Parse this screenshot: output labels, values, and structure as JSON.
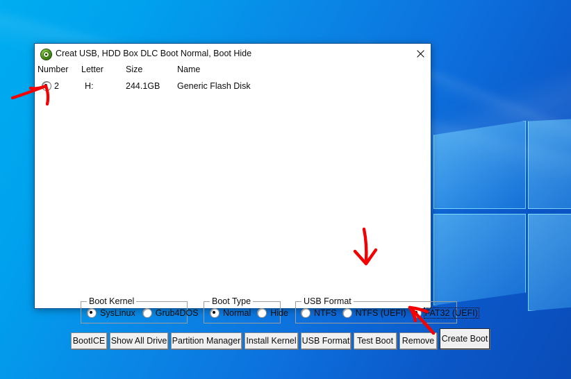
{
  "window": {
    "title": "Creat USB, HDD Box DLC Boot Normal, Boot Hide",
    "icon": "green-disc-icon",
    "close_label": "×"
  },
  "list": {
    "columns": [
      "Number",
      "Letter",
      "Size",
      "Name"
    ],
    "rows": [
      {
        "selected": true,
        "number": "2",
        "letter": "H:",
        "size": "244.1GB",
        "name": "Generic Flash Disk"
      }
    ]
  },
  "groups": [
    {
      "id": "boot-kernel",
      "title": "Boot Kernel",
      "options": [
        {
          "label": "SysLinux",
          "checked": true,
          "focused": false
        },
        {
          "label": "Grub4DOS",
          "checked": false,
          "focused": false
        }
      ]
    },
    {
      "id": "boot-type",
      "title": "Boot Type",
      "options": [
        {
          "label": "Normal",
          "checked": true,
          "focused": false
        },
        {
          "label": "Hide",
          "checked": false,
          "focused": false
        }
      ]
    },
    {
      "id": "usb-format",
      "title": "USB Format",
      "options": [
        {
          "label": "NTFS",
          "checked": false,
          "focused": false
        },
        {
          "label": "NTFS (UEFI)",
          "checked": false,
          "focused": false
        },
        {
          "label": "FAT32 (UEFI)",
          "checked": true,
          "focused": true
        }
      ]
    }
  ],
  "buttons": [
    {
      "label": "BootICE",
      "default": false
    },
    {
      "label": "Show All Drive",
      "default": false
    },
    {
      "label": "Partition Manager",
      "default": false
    },
    {
      "label": "Install Kernel",
      "default": false
    },
    {
      "label": "USB Format",
      "default": false
    },
    {
      "label": "Test Boot",
      "default": false
    },
    {
      "label": "Remove",
      "default": false
    },
    {
      "label": "Create Boot",
      "default": true
    }
  ],
  "annotations": {
    "color": "#f50000",
    "arrows": [
      {
        "name": "arrow-to-device-radio",
        "points_at": "device-row-radio"
      },
      {
        "name": "arrow-to-fat32-uefi",
        "points_at": "usb-format-fat32-uefi"
      },
      {
        "name": "arrow-to-create-boot",
        "points_at": "create-boot-button"
      }
    ]
  },
  "desktop": {
    "wallpaper": "windows-10-blue-logo",
    "accent": "#0a78dc"
  }
}
